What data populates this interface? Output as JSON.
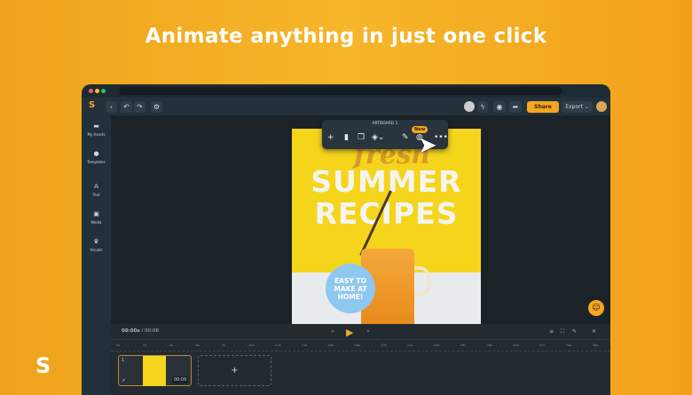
{
  "headline": "Animate anything in just one click",
  "toolbar": {
    "share": "Share",
    "export": "Export"
  },
  "sidebar": [
    {
      "icon": "folder-icon",
      "glyph": "▬",
      "label": "My Assets"
    },
    {
      "icon": "templates-icon",
      "glyph": "●",
      "label": "Templates"
    },
    {
      "icon": "text-icon",
      "glyph": "A",
      "label": "Text"
    },
    {
      "icon": "media-icon",
      "glyph": "▣",
      "label": "Media"
    },
    {
      "icon": "visuals-icon",
      "glyph": "♛",
      "label": "Visuals"
    }
  ],
  "floating_toolbar": {
    "title": "ARTBOARD 1",
    "badge": "New"
  },
  "poster": {
    "script": "fresh",
    "title_line1": "SUMMER",
    "title_line2": "RECIPES",
    "badge": "EASY TO MAKE AT HOME!"
  },
  "timeline": {
    "current": "00:00s",
    "total": "/ 00:06",
    "ticks": [
      "0s",
      "2s",
      "4s",
      "6s",
      "8s",
      "10s",
      "12s",
      "14s",
      "16s",
      "18s",
      "20s",
      "22s",
      "24s",
      "26s",
      "28s",
      "30s",
      "32s",
      "34s",
      "36s"
    ],
    "clip": {
      "index": "1",
      "duration": "00:06"
    }
  },
  "colors": {
    "accent": "#f5a623",
    "background": "#f2a01a"
  }
}
